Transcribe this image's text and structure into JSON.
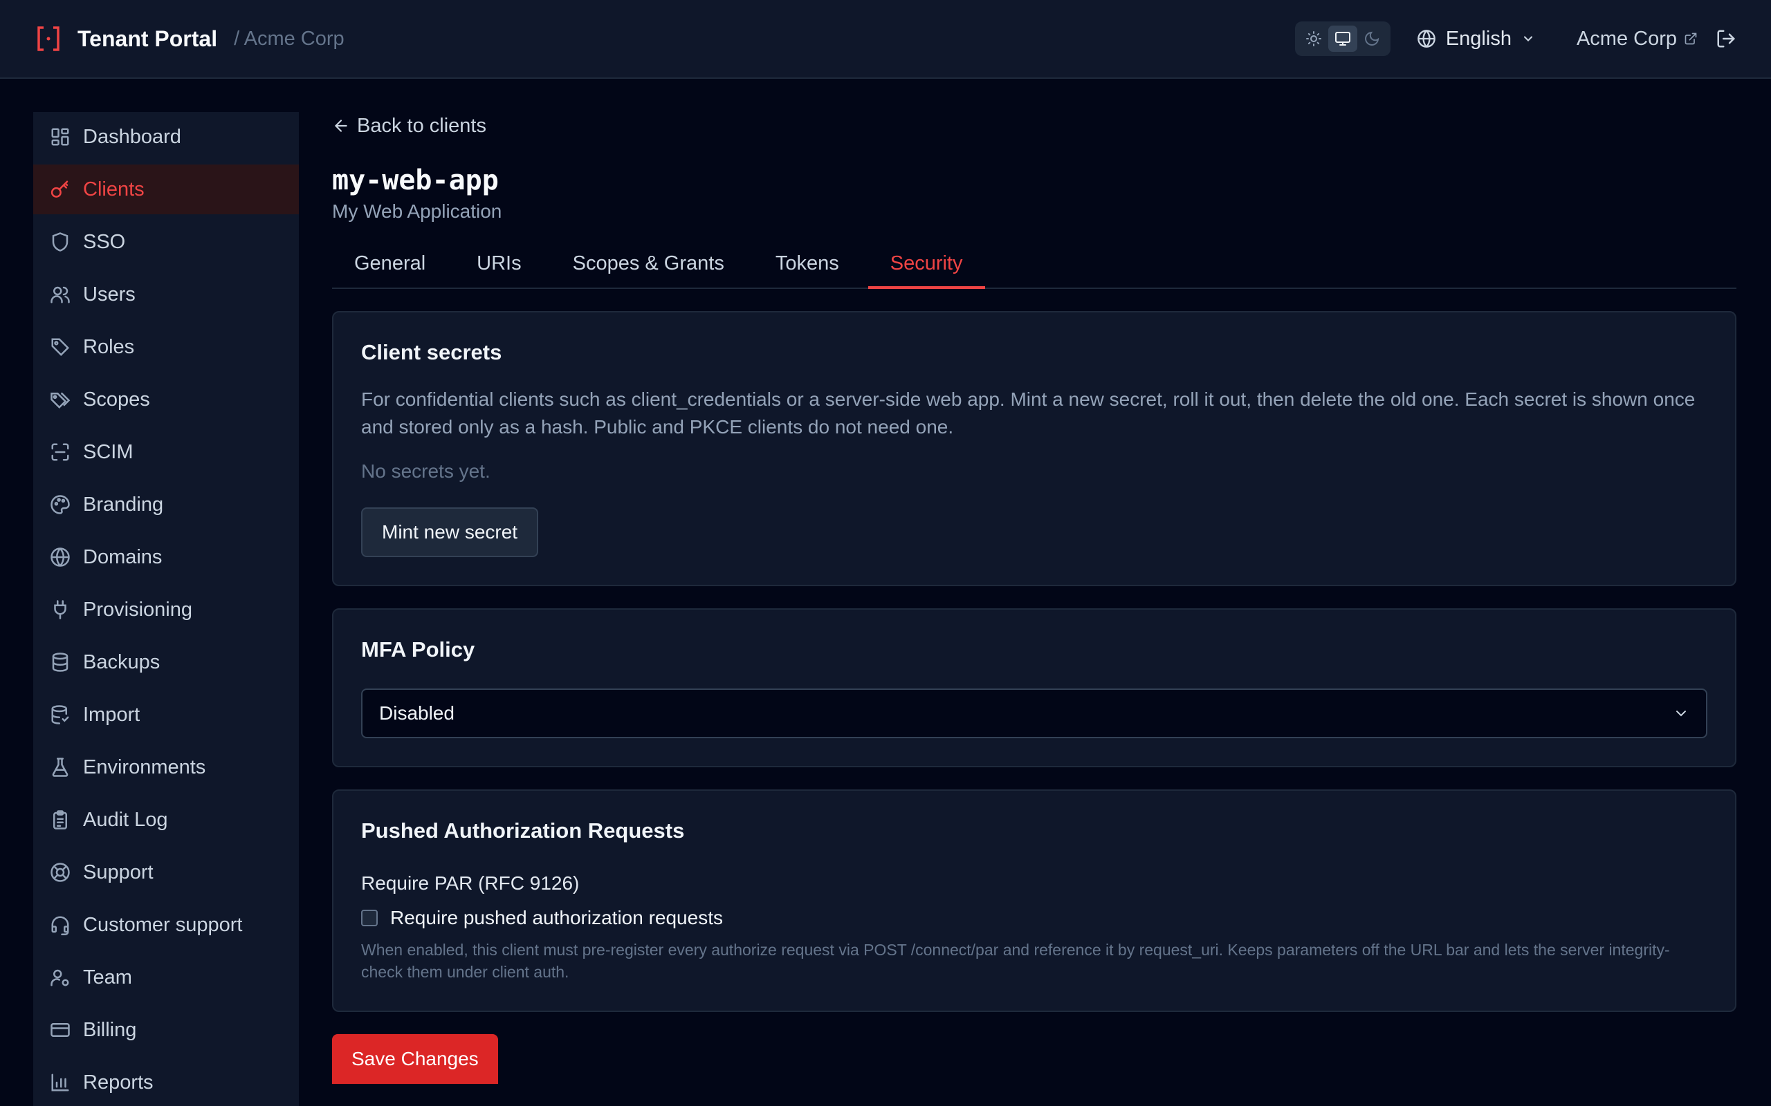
{
  "header": {
    "title": "Tenant Portal",
    "tenant": "/ Acme Corp",
    "language": "English",
    "org_link": "Acme Corp",
    "accent_color": "#ef4444"
  },
  "sidebar": {
    "items": [
      {
        "label": "Dashboard",
        "icon": "dashboard-icon"
      },
      {
        "label": "Clients",
        "icon": "key-icon",
        "active": true
      },
      {
        "label": "SSO",
        "icon": "shield-icon"
      },
      {
        "label": "Users",
        "icon": "users-icon"
      },
      {
        "label": "Roles",
        "icon": "tag-icon"
      },
      {
        "label": "Scopes",
        "icon": "tags-icon"
      },
      {
        "label": "SCIM",
        "icon": "scan-icon"
      },
      {
        "label": "Branding",
        "icon": "palette-icon"
      },
      {
        "label": "Domains",
        "icon": "globe-icon"
      },
      {
        "label": "Provisioning",
        "icon": "plug-icon"
      },
      {
        "label": "Backups",
        "icon": "database-icon"
      },
      {
        "label": "Import",
        "icon": "database-import-icon"
      },
      {
        "label": "Environments",
        "icon": "flask-icon"
      },
      {
        "label": "Audit Log",
        "icon": "clipboard-icon"
      },
      {
        "label": "Support",
        "icon": "lifebuoy-icon"
      },
      {
        "label": "Customer support",
        "icon": "headset-icon"
      },
      {
        "label": "Team",
        "icon": "user-cog-icon"
      },
      {
        "label": "Billing",
        "icon": "credit-card-icon"
      },
      {
        "label": "Reports",
        "icon": "bar-chart-icon"
      }
    ]
  },
  "main": {
    "back_label": "Back to clients",
    "client_id": "my-web-app",
    "client_name": "My Web Application",
    "tabs": [
      {
        "label": "General"
      },
      {
        "label": "URIs"
      },
      {
        "label": "Scopes & Grants"
      },
      {
        "label": "Tokens"
      },
      {
        "label": "Security",
        "active": true
      }
    ],
    "secrets": {
      "title": "Client secrets",
      "description": "For confidential clients such as client_credentials or a server-side web app. Mint a new secret, roll it out, then delete the old one. Each secret is shown once and stored only as a hash. Public and PKCE clients do not need one.",
      "empty": "No secrets yet.",
      "mint_label": "Mint new secret"
    },
    "mfa": {
      "title": "MFA Policy",
      "selected": "Disabled"
    },
    "par": {
      "title": "Pushed Authorization Requests",
      "field_label": "Require PAR (RFC 9126)",
      "checkbox_label": "Require pushed authorization requests",
      "checked": false,
      "hint": "When enabled, this client must pre-register every authorize request via POST /connect/par and reference it by request_uri. Keeps parameters off the URL bar and lets the server integrity-check them under client auth."
    },
    "save_label": "Save Changes"
  }
}
